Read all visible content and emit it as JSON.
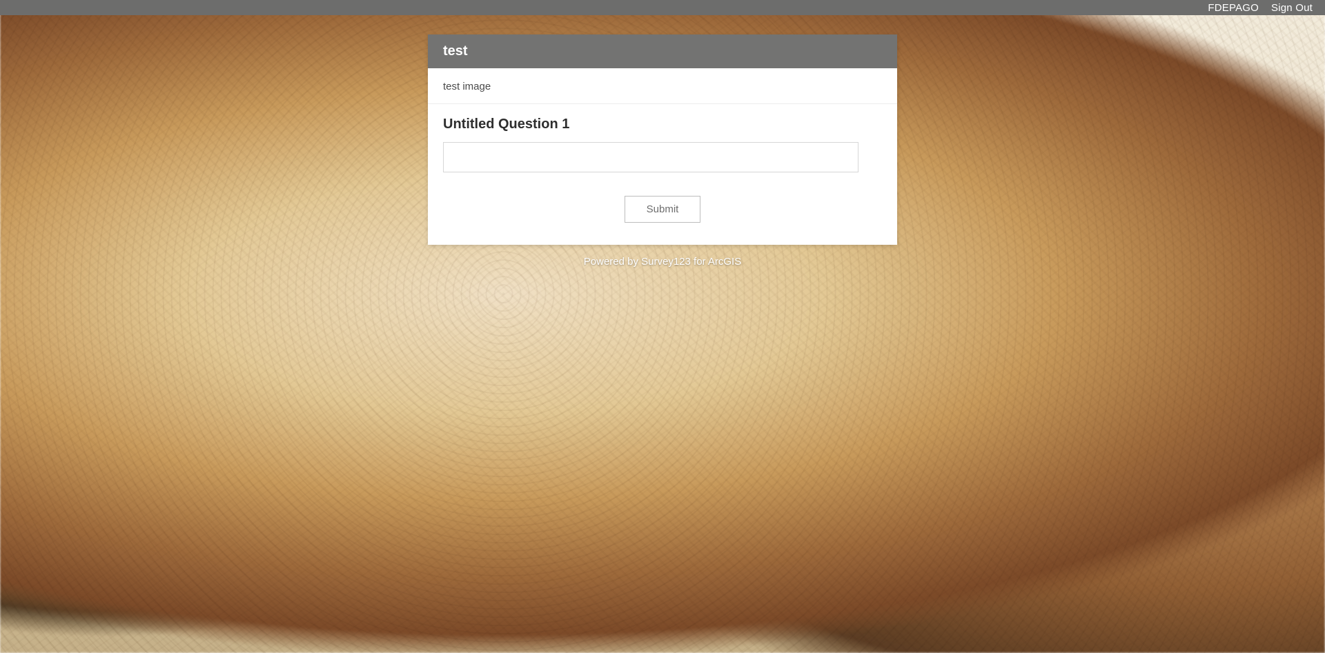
{
  "header": {
    "username_label": "FDEPAGO",
    "sign_out_label": "Sign Out"
  },
  "survey": {
    "title": "test",
    "description": "test image",
    "questions": [
      {
        "label": "Untitled Question 1",
        "value": ""
      }
    ],
    "submit_label": "Submit"
  },
  "footer": {
    "powered_by": "Powered by Survey123 for ArcGIS"
  }
}
